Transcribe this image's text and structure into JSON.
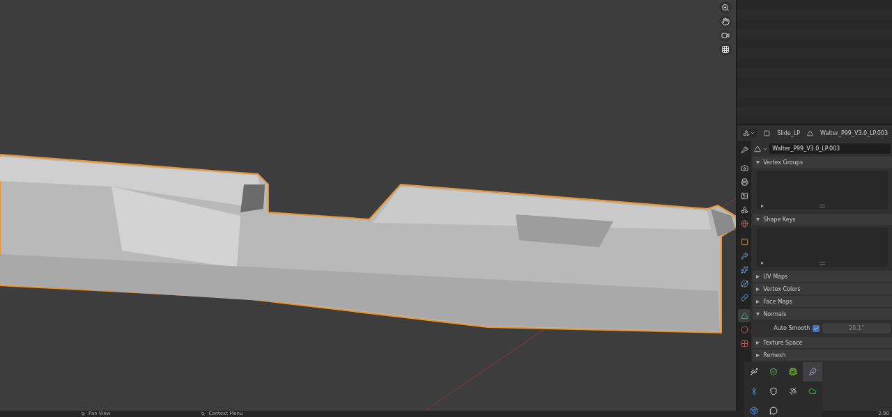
{
  "properties": {
    "header": {
      "object": "Slide_LP",
      "mesh": "Walter_P99_V3.0_LP.003"
    },
    "datablock": "Walter_P99_V3.0_LP.003",
    "tabs": [
      {
        "kind": "tool",
        "selected": false
      },
      {
        "kind": "render",
        "selected": false
      },
      {
        "kind": "output",
        "selected": false
      },
      {
        "kind": "viewlayer",
        "selected": false
      },
      {
        "kind": "scene",
        "selected": false
      },
      {
        "kind": "world",
        "selected": false
      },
      {
        "kind": "object",
        "selected": false
      },
      {
        "kind": "modifiers",
        "selected": false
      },
      {
        "kind": "particles",
        "selected": false
      },
      {
        "kind": "physics",
        "selected": false
      },
      {
        "kind": "constraints",
        "selected": false
      },
      {
        "kind": "data",
        "selected": true
      },
      {
        "kind": "material",
        "selected": false
      },
      {
        "kind": "texture",
        "selected": false
      }
    ],
    "panels": [
      {
        "kind": "list",
        "title": "Vertex Groups",
        "expanded": true
      },
      {
        "kind": "list",
        "title": "Shape Keys",
        "expanded": true
      },
      {
        "kind": "plain",
        "title": "UV Maps",
        "expanded": false
      },
      {
        "kind": "plain",
        "title": "Vertex Colors",
        "expanded": false
      },
      {
        "kind": "plain",
        "title": "Face Maps",
        "expanded": false
      },
      {
        "kind": "normals",
        "title": "Normals",
        "expanded": true,
        "label": "Auto Smooth",
        "checked": true,
        "value": "26.1°"
      },
      {
        "kind": "plain",
        "title": "Texture Space",
        "expanded": false
      },
      {
        "kind": "plain",
        "title": "Remesh",
        "expanded": false
      }
    ]
  },
  "tray": [
    {
      "kind": "usb",
      "selected": false
    },
    {
      "kind": "shield-check",
      "selected": false
    },
    {
      "kind": "gpu",
      "selected": false
    },
    {
      "kind": "feather",
      "selected": true
    },
    {
      "kind": "bluetooth",
      "selected": false
    },
    {
      "kind": "security",
      "selected": false
    },
    {
      "kind": "satellite",
      "selected": false
    },
    {
      "kind": "cloud",
      "selected": false
    },
    {
      "kind": "browser",
      "selected": false
    },
    {
      "kind": "chat",
      "selected": false
    }
  ],
  "status_bar": {
    "hints": [
      "Pan View",
      "Context Menu"
    ],
    "version": "2.90"
  }
}
